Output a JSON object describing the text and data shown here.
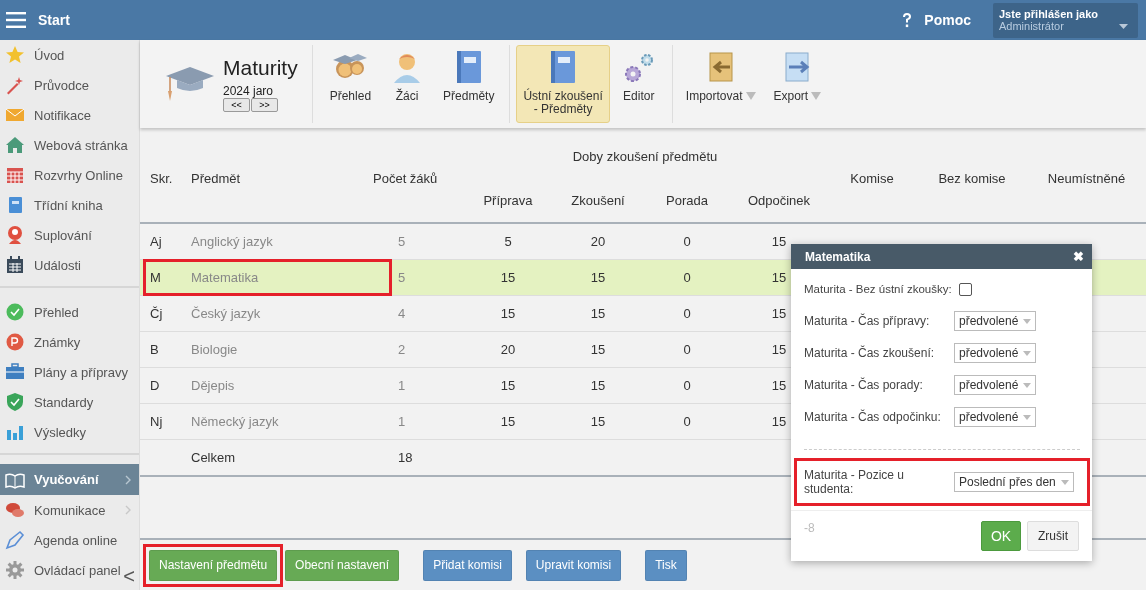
{
  "topbar": {
    "title": "Start",
    "help": "Pomoc",
    "user_label": "Jste přihlášen jako",
    "user_name": "Administrátor"
  },
  "sidebar": {
    "groups": [
      [
        {
          "label": "Úvod",
          "selected": false,
          "submenu": false
        },
        {
          "label": "Průvodce",
          "selected": false,
          "submenu": false
        },
        {
          "label": "Notifikace",
          "selected": false,
          "submenu": false
        },
        {
          "label": "Webová stránka",
          "selected": false,
          "submenu": false
        },
        {
          "label": "Rozvrhy Online",
          "selected": false,
          "submenu": false
        },
        {
          "label": "Třídní kniha",
          "selected": false,
          "submenu": false
        },
        {
          "label": "Suplování",
          "selected": false,
          "submenu": false
        },
        {
          "label": "Události",
          "selected": false,
          "submenu": false
        }
      ],
      [
        {
          "label": "Přehled",
          "selected": false,
          "submenu": false
        },
        {
          "label": "Známky",
          "selected": false,
          "submenu": false
        },
        {
          "label": "Plány a přípravy",
          "selected": false,
          "submenu": false
        },
        {
          "label": "Standardy",
          "selected": false,
          "submenu": false
        },
        {
          "label": "Výsledky",
          "selected": false,
          "submenu": false
        }
      ],
      [
        {
          "label": "Vyučování",
          "selected": true,
          "submenu": true
        },
        {
          "label": "Komunikace",
          "selected": false,
          "submenu": true
        },
        {
          "label": "Agenda online",
          "selected": false,
          "submenu": false
        },
        {
          "label": "Ovládací panel",
          "selected": false,
          "submenu": false
        }
      ]
    ],
    "collapse": "<"
  },
  "toolbar": {
    "title": "Maturity",
    "period": "2024 jaro",
    "prev": "<<",
    "next": ">>",
    "groups": [
      [
        {
          "label": "Přehled",
          "selected": false,
          "dropdown": false
        },
        {
          "label": "Žáci",
          "selected": false,
          "dropdown": false
        },
        {
          "label": "Předměty",
          "selected": false,
          "dropdown": false
        }
      ],
      [
        {
          "label": "Ústní zkoušení\n- Předměty",
          "selected": true,
          "dropdown": false
        },
        {
          "label": "Editor",
          "selected": false,
          "dropdown": false
        }
      ],
      [
        {
          "label": "Importovat",
          "selected": false,
          "dropdown": true
        },
        {
          "label": "Export",
          "selected": false,
          "dropdown": true
        }
      ]
    ]
  },
  "table": {
    "group_heading": "Doby zkoušení předmětu",
    "columns": [
      {
        "label": "Skr.",
        "grouped": false
      },
      {
        "label": "Předmět",
        "grouped": false
      },
      {
        "label": "Počet žáků",
        "grouped": false
      },
      {
        "label": "Příprava",
        "grouped": true
      },
      {
        "label": "Zkoušení",
        "grouped": true
      },
      {
        "label": "Porada",
        "grouped": true
      },
      {
        "label": "Odpočinek",
        "grouped": true
      },
      {
        "label": "Komise",
        "grouped": false
      },
      {
        "label": "Bez komise",
        "grouped": false
      },
      {
        "label": "Neumístněné",
        "grouped": false
      }
    ],
    "rows": [
      {
        "cells": [
          "Aj",
          "Anglický jazyk",
          "5",
          "5",
          "20",
          "0",
          "15"
        ],
        "selected": false,
        "highlighted": false
      },
      {
        "cells": [
          "M",
          "Matematika",
          "5",
          "15",
          "15",
          "0",
          "15"
        ],
        "selected": true,
        "highlighted": true
      },
      {
        "cells": [
          "Čj",
          "Český jazyk",
          "4",
          "15",
          "15",
          "0",
          "15"
        ],
        "selected": false,
        "highlighted": false
      },
      {
        "cells": [
          "B",
          "Biologie",
          "2",
          "20",
          "15",
          "0",
          "15"
        ],
        "selected": false,
        "highlighted": false
      },
      {
        "cells": [
          "D",
          "Dějepis",
          "1",
          "15",
          "15",
          "0",
          "15"
        ],
        "selected": false,
        "highlighted": false
      },
      {
        "cells": [
          "Nj",
          "Německý jazyk",
          "1",
          "15",
          "15",
          "0",
          "15"
        ],
        "selected": false,
        "highlighted": false
      }
    ],
    "total": {
      "label": "Celkem",
      "count": "18"
    }
  },
  "buttons": [
    [
      {
        "label": "Nastavení předmětu",
        "color": "#67aa55",
        "highlighted": true
      },
      {
        "label": "Obecní nastavení",
        "color": "#67aa55",
        "highlighted": false
      }
    ],
    [
      {
        "label": "Přidat komisi",
        "color": "#5b8fc2",
        "highlighted": false
      },
      {
        "label": "Upravit komisi",
        "color": "#5b8fc2",
        "highlighted": false
      }
    ],
    [
      {
        "label": "Tisk",
        "color": "#5b8fc2",
        "highlighted": false
      }
    ]
  ],
  "dialog": {
    "title": "Matematika",
    "close": "✖",
    "fields": [
      {
        "kind": "checkbox",
        "label": "Maturita - Bez ústní zkoušky:",
        "checked": false
      },
      {
        "kind": "select",
        "label": "Maturita - Čas přípravy:",
        "value": "předvolené"
      },
      {
        "kind": "select",
        "label": "Maturita - Čas zkoušení:",
        "value": "předvolené"
      },
      {
        "kind": "select",
        "label": "Maturita - Čas porady:",
        "value": "předvolené"
      },
      {
        "kind": "select",
        "label": "Maturita - Čas odpočinku:",
        "value": "předvolené"
      }
    ],
    "extra_fields": [
      {
        "kind": "select",
        "label": "Maturita - Pozice u studenta:",
        "value": "Poslední přes den",
        "highlighted": true
      }
    ],
    "footnote": "-8",
    "ok": "OK",
    "cancel": "Zrušit"
  }
}
